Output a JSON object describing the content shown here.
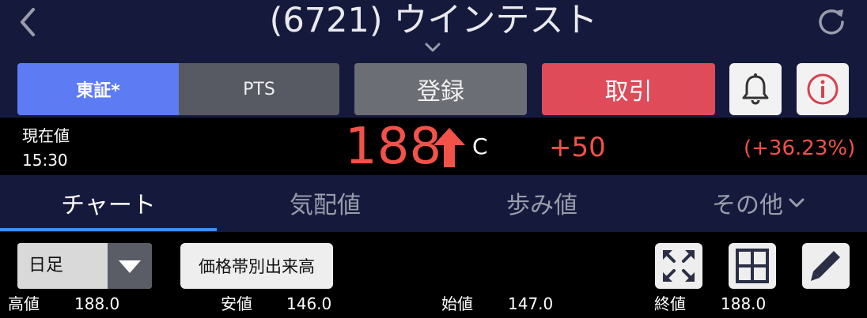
{
  "header": {
    "title": "(6721) ウインテスト",
    "back_icon": "chevron-left-icon",
    "refresh_icon": "refresh-icon"
  },
  "market_tabs": {
    "tse": "東証*",
    "pts": "PTS"
  },
  "actions": {
    "register": "登録",
    "trade": "取引",
    "alert_icon": "bell-icon",
    "info_icon": "info-icon"
  },
  "quote": {
    "label": "現在値",
    "time": "15:30",
    "price": "188",
    "marker": "C",
    "change": "+50",
    "change_pct": "(+36.23%)",
    "color_up": "#f25248"
  },
  "tabs": {
    "chart": "チャート",
    "board": "気配値",
    "ticks": "歩み値",
    "other": "その他"
  },
  "toolbar": {
    "period": "日足",
    "volume_profile": "価格帯別出来高"
  },
  "ohlc": {
    "high_label": "高値",
    "high": "188.0",
    "low_label": "安値",
    "low": "146.0",
    "open_label": "始値",
    "open": "147.0",
    "close_label": "終値",
    "close": "188.0"
  },
  "colors": {
    "header_bg": "#151a3d",
    "accent_blue": "#5d7bf2",
    "tab_active": "#3f8ef5",
    "trade_red": "#df4b59"
  }
}
